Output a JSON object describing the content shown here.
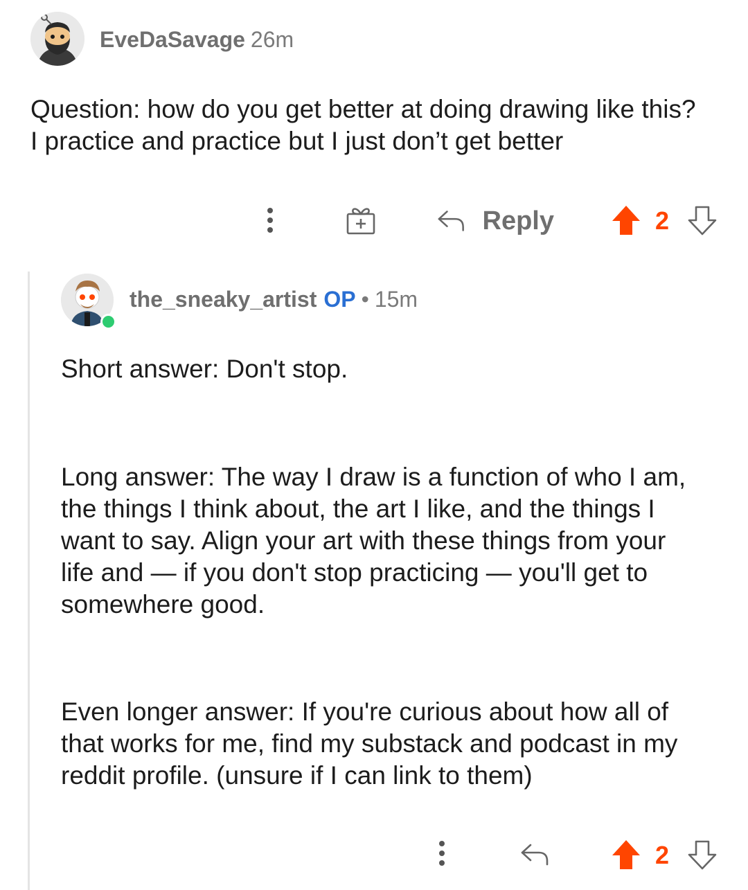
{
  "parent_comment": {
    "author": "EveDaSavage",
    "time": "26m",
    "text_lines": [
      "Question: how do you get better at doing drawing like this?",
      "I practice and practice but I just don’t get better"
    ],
    "actions": {
      "more_icon": "more-vertical-icon",
      "award_icon": "gift-icon",
      "reply_icon": "reply-arrow-icon",
      "reply_label": "Reply",
      "upvote_icon": "upvote-arrow-icon",
      "vote_count": "2",
      "downvote_icon": "downvote-arrow-icon"
    }
  },
  "reply_comment": {
    "author": "the_sneaky_artist",
    "op_badge": "OP",
    "separator": "•",
    "time": "15m",
    "paragraphs": [
      [
        "Short answer: Don't stop."
      ],
      [
        "Long answer: The way I draw is a function of who I am,",
        "the things I think about, the art I like, and the things I",
        "want to say. Align your art with these things from your",
        "life and — if you don't stop practicing — you'll get to",
        "somewhere good."
      ],
      [
        "Even longer answer: If you're curious about how all of",
        "that works for me, find my substack and podcast in my",
        "reddit profile. (unsure if I can link to them)"
      ]
    ],
    "actions": {
      "more_icon": "more-vertical-icon",
      "reply_icon": "reply-arrow-icon",
      "upvote_icon": "upvote-arrow-icon",
      "vote_count": "2",
      "downvote_icon": "downvote-arrow-icon"
    },
    "online": true
  },
  "colors": {
    "upvote": "#ff4500",
    "op_badge": "#2a6fd3",
    "online": "#2ecc71",
    "meta_text": "#6f6f6f",
    "body_text": "#1c1c1c"
  }
}
